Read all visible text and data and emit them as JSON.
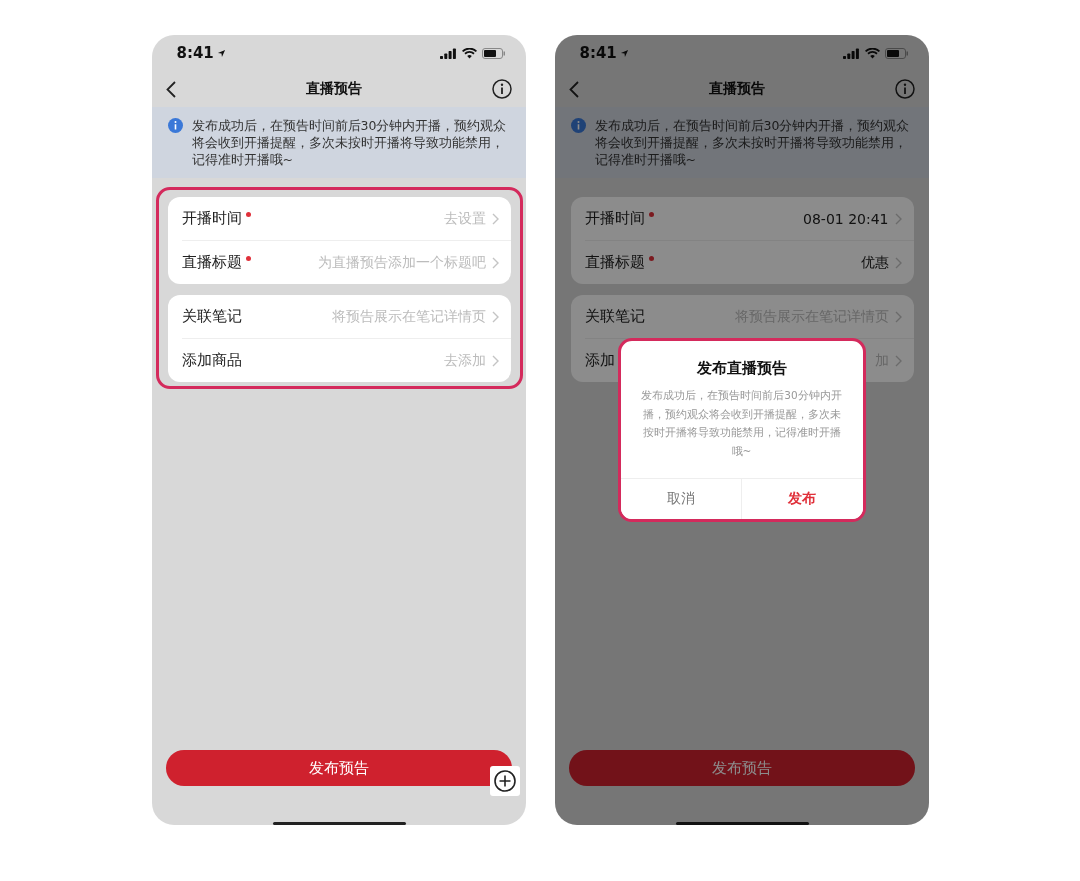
{
  "screens": [
    {
      "status_bar": {
        "time": "8:41"
      },
      "nav": {
        "title": "直播预告"
      },
      "notice": "发布成功后，在预告时间前后30分钟内开播，预约观众将会收到开播提醒，多次未按时开播将导致功能禁用，记得准时开播哦~",
      "form": {
        "highlighted": true,
        "groups": [
          [
            {
              "label": "开播时间",
              "required": true,
              "placeholder": "去设置"
            },
            {
              "label": "直播标题",
              "required": true,
              "placeholder": "为直播预告添加一个标题吧"
            }
          ],
          [
            {
              "label": "关联笔记",
              "placeholder": "将预告展示在笔记详情页"
            },
            {
              "label": "添加商品",
              "placeholder": "去添加"
            }
          ]
        ]
      },
      "submit": "发布预告",
      "floating_add": true
    },
    {
      "status_bar": {
        "time": "8:41"
      },
      "nav": {
        "title": "直播预告"
      },
      "notice": "发布成功后，在预告时间前后30分钟内开播，预约观众将会收到开播提醒，多次未按时开播将导致功能禁用，记得准时开播哦~",
      "form": {
        "highlighted": false,
        "groups": [
          [
            {
              "label": "开播时间",
              "required": true,
              "value": "08-01 20:41"
            },
            {
              "label": "直播标题",
              "required": true,
              "value": "优惠"
            }
          ],
          [
            {
              "label": "关联笔记",
              "placeholder": "将预告展示在笔记详情页"
            },
            {
              "label": "添加",
              "placeholder": "加"
            }
          ]
        ]
      },
      "submit": "发布预告",
      "dimmed": true,
      "dialog": {
        "highlighted": true,
        "title": "发布直播预告",
        "message": "发布成功后，在预告时间前后30分钟内开播，预约观众将会收到开播提醒，多次未按时开播将导致功能禁用，记得准时开播哦~",
        "buttons": [
          {
            "label": "取消",
            "kind": "cancel"
          },
          {
            "label": "发布",
            "kind": "confirm"
          }
        ]
      }
    }
  ]
}
